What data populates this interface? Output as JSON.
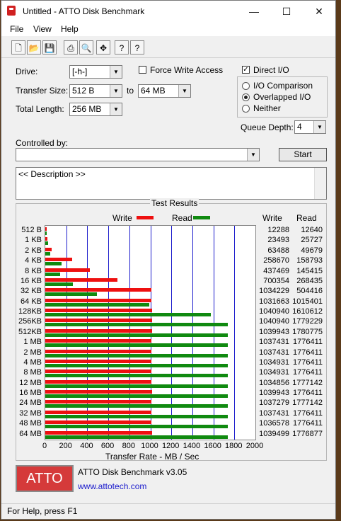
{
  "window": {
    "title": "Untitled - ATTO Disk Benchmark",
    "minimize": "—",
    "maximize": "☐",
    "close": "✕"
  },
  "menu": [
    "File",
    "View",
    "Help"
  ],
  "toolbar": [
    "new",
    "open",
    "save",
    "print",
    "preview",
    "move",
    "help",
    "context-help"
  ],
  "form": {
    "drive_label": "Drive:",
    "drive_value": "[-h-]",
    "force_write_label": "Force Write Access",
    "direct_io_label": "Direct I/O",
    "transfer_size_label": "Transfer Size:",
    "ts_from": "512 B",
    "to_label": "to",
    "ts_to": "64 MB",
    "total_length_label": "Total Length:",
    "total_length": "256 MB",
    "io_comparison": "I/O Comparison",
    "overlapped_io": "Overlapped I/O",
    "neither": "Neither",
    "queue_depth_label": "Queue Depth:",
    "queue_depth": "4",
    "controlled_by_label": "Controlled by:",
    "start_button": "Start",
    "description": "<< Description >>"
  },
  "results": {
    "title": "Test Results",
    "legend_write": "Write",
    "legend_read": "Read",
    "col_write": "Write",
    "col_read": "Read",
    "xlabel": "Transfer Rate - MB / Sec"
  },
  "chart_data": {
    "type": "bar",
    "categories": [
      "512 B",
      "1 KB",
      "2 KB",
      "4 KB",
      "8 KB",
      "16 KB",
      "32 KB",
      "64 KB",
      "128KB",
      "256KB",
      "512KB",
      "1 MB",
      "2 MB",
      "4 MB",
      "8 MB",
      "12 MB",
      "16 MB",
      "24 MB",
      "32 MB",
      "48 MB",
      "64 MB"
    ],
    "series": [
      {
        "name": "Write",
        "color": "#ee1010",
        "values": [
          12288,
          23493,
          63488,
          258670,
          437469,
          700354,
          1034229,
          1031663,
          1040940,
          1040940,
          1039943,
          1037431,
          1037431,
          1034931,
          1034931,
          1034856,
          1039943,
          1037279,
          1037431,
          1036578,
          1039499
        ]
      },
      {
        "name": "Read",
        "color": "#108a10",
        "values": [
          12640,
          25727,
          49679,
          158793,
          145415,
          268435,
          504416,
          1015401,
          1610612,
          1779229,
          1780775,
          1776411,
          1776411,
          1776411,
          1776411,
          1777142,
          1776411,
          1777142,
          1776411,
          1776411,
          1776877
        ]
      }
    ],
    "xlabel": "Transfer Rate - MB / Sec",
    "xticks": [
      "0",
      "200",
      "400",
      "600",
      "800",
      "1000",
      "1200",
      "1400",
      "1600",
      "1800",
      "2000"
    ],
    "xlim": [
      0,
      2000
    ]
  },
  "footer": {
    "logo": "ATTO",
    "product": "ATTO Disk Benchmark v3.05",
    "url": "www.attotech.com"
  },
  "status": "For Help, press F1"
}
